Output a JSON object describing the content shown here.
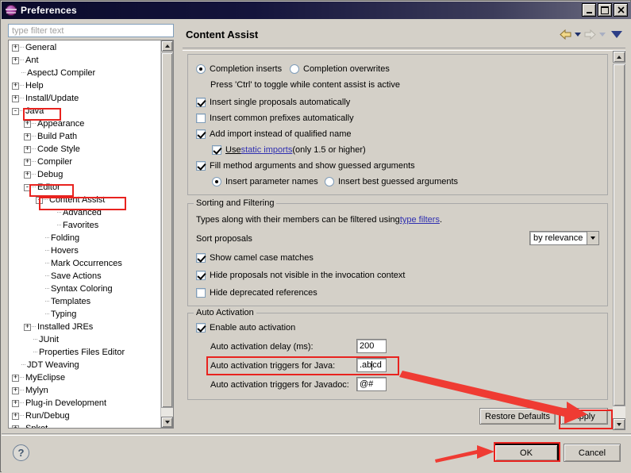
{
  "window": {
    "title": "Preferences",
    "icon": "eclipse-globe-icon",
    "minimize_label": "_",
    "maximize_label": "□",
    "close_label": "×"
  },
  "sidebar": {
    "filter_placeholder": "type filter text",
    "filter_value": "",
    "items": [
      {
        "label": "General",
        "depth": 0,
        "toggle": "+",
        "highlight": false
      },
      {
        "label": "Ant",
        "depth": 0,
        "toggle": "+",
        "highlight": false
      },
      {
        "label": "AspectJ Compiler",
        "depth": 0,
        "toggle": "",
        "highlight": false
      },
      {
        "label": "Help",
        "depth": 0,
        "toggle": "+",
        "highlight": false
      },
      {
        "label": "Install/Update",
        "depth": 0,
        "toggle": "+",
        "highlight": false
      },
      {
        "label": "Java",
        "depth": 0,
        "toggle": "-",
        "highlight": true
      },
      {
        "label": "Appearance",
        "depth": 1,
        "toggle": "+",
        "highlight": false
      },
      {
        "label": "Build Path",
        "depth": 1,
        "toggle": "+",
        "highlight": false
      },
      {
        "label": "Code Style",
        "depth": 1,
        "toggle": "+",
        "highlight": false
      },
      {
        "label": "Compiler",
        "depth": 1,
        "toggle": "+",
        "highlight": false
      },
      {
        "label": "Debug",
        "depth": 1,
        "toggle": "+",
        "highlight": false
      },
      {
        "label": "Editor",
        "depth": 1,
        "toggle": "-",
        "highlight": true
      },
      {
        "label": "Content Assist",
        "depth": 2,
        "toggle": "-",
        "highlight": true
      },
      {
        "label": "Advanced",
        "depth": 3,
        "toggle": "",
        "highlight": false
      },
      {
        "label": "Favorites",
        "depth": 3,
        "toggle": "",
        "highlight": false
      },
      {
        "label": "Folding",
        "depth": 2,
        "toggle": "",
        "highlight": false
      },
      {
        "label": "Hovers",
        "depth": 2,
        "toggle": "",
        "highlight": false
      },
      {
        "label": "Mark Occurrences",
        "depth": 2,
        "toggle": "",
        "highlight": false
      },
      {
        "label": "Save Actions",
        "depth": 2,
        "toggle": "",
        "highlight": false
      },
      {
        "label": "Syntax Coloring",
        "depth": 2,
        "toggle": "",
        "highlight": false
      },
      {
        "label": "Templates",
        "depth": 2,
        "toggle": "",
        "highlight": false
      },
      {
        "label": "Typing",
        "depth": 2,
        "toggle": "",
        "highlight": false
      },
      {
        "label": "Installed JREs",
        "depth": 1,
        "toggle": "+",
        "highlight": false
      },
      {
        "label": "JUnit",
        "depth": 1,
        "toggle": "",
        "highlight": false
      },
      {
        "label": "Properties Files Editor",
        "depth": 1,
        "toggle": "",
        "highlight": false
      },
      {
        "label": "JDT Weaving",
        "depth": 0,
        "toggle": "",
        "highlight": false
      },
      {
        "label": "MyEclipse",
        "depth": 0,
        "toggle": "+",
        "highlight": false
      },
      {
        "label": "Mylyn",
        "depth": 0,
        "toggle": "+",
        "highlight": false
      },
      {
        "label": "Plug-in Development",
        "depth": 0,
        "toggle": "+",
        "highlight": false
      },
      {
        "label": "Run/Debug",
        "depth": 0,
        "toggle": "+",
        "highlight": false
      },
      {
        "label": "Spket",
        "depth": 0,
        "toggle": "+",
        "highlight": false
      }
    ]
  },
  "main": {
    "page_title": "Content Assist",
    "nav": {
      "back_icon": "back-arrow-icon",
      "back_dropdown_icon": "chevron-down-icon",
      "forward_icon": "forward-arrow-icon",
      "forward_dropdown_icon": "chevron-down-icon",
      "menu_icon": "view-menu-icon"
    },
    "insertion": {
      "completion_inserts": "Completion inserts",
      "completion_inserts_selected": true,
      "completion_overwrites": "Completion overwrites",
      "completion_overwrites_selected": false,
      "hint": "Press 'Ctrl' to toggle while content assist is active",
      "options": [
        {
          "label": "Insert single proposals automatically",
          "checked": true
        },
        {
          "label": "Insert common prefixes automatically",
          "checked": false
        },
        {
          "label": "Add import instead of qualified name",
          "checked": true
        }
      ],
      "static_imports": {
        "checked": true,
        "prefix": "Use ",
        "link": "static imports",
        "suffix": " (only 1.5 or higher)"
      },
      "fill_args": {
        "label": "Fill method arguments and show guessed arguments",
        "checked": true
      },
      "insert_parameter_names": "Insert parameter names",
      "insert_parameter_names_selected": true,
      "insert_best_guessed": "Insert best guessed arguments",
      "insert_best_guessed_selected": false
    },
    "sorting": {
      "group_title": "Sorting and Filtering",
      "desc_prefix": "Types along with their members can be filtered using ",
      "desc_link": "type filters",
      "desc_suffix": ".",
      "sort_label": "Sort proposals",
      "sort_value": "by relevance",
      "options": [
        {
          "label": "Show camel case matches",
          "checked": true
        },
        {
          "label": "Hide proposals not visible in the invocation context",
          "checked": true
        },
        {
          "label": "Hide deprecated references",
          "checked": false
        }
      ]
    },
    "auto_activation": {
      "group_title": "Auto Activation",
      "enable_label": "Enable auto activation",
      "enable_checked": true,
      "delay_label": "Auto activation delay (ms):",
      "delay_value": "200",
      "java_label": "Auto activation triggers for Java:",
      "java_value_before_caret": ".ab",
      "java_value_after_caret": "cd",
      "java_highlighted": true,
      "javadoc_label": "Auto activation triggers for Javadoc:",
      "javadoc_value": "@#"
    },
    "buttons": {
      "restore_defaults": "Restore Defaults",
      "apply": "Apply"
    }
  },
  "footer": {
    "help_icon": "help-question-icon",
    "ok": "OK",
    "cancel": "Cancel",
    "ok_highlighted": true
  },
  "annotations": {
    "highlight_color": "#e8231f",
    "arrow_field_to_apply": "red-arrow-to-apply",
    "arrow_to_ok": "red-arrow-to-ok",
    "box_java_field": "red-box-java-triggers",
    "box_tree_java": "red-box-tree-java",
    "box_tree_editor": "red-box-tree-editor",
    "box_tree_content_assist": "red-box-tree-content-assist",
    "box_apply": "red-box-apply",
    "box_ok": "red-box-ok"
  }
}
